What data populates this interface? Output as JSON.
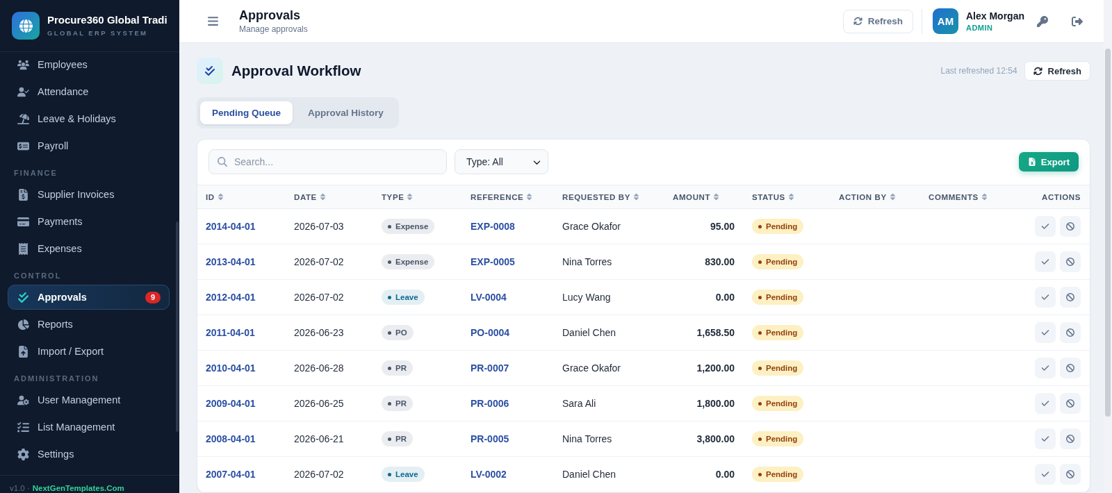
{
  "sidebar": {
    "brand": {
      "title": "Procure360 Global Tradi",
      "subtitle": "GLOBAL ERP SYSTEM"
    },
    "sections": [
      {
        "items": [
          {
            "label": "Employees",
            "selected": false
          },
          {
            "label": "Attendance",
            "selected": false
          },
          {
            "label": "Leave & Holidays",
            "selected": false
          },
          {
            "label": "Payroll",
            "selected": false
          }
        ]
      },
      {
        "label": "FINANCE",
        "items": [
          {
            "label": "Supplier Invoices",
            "selected": false
          },
          {
            "label": "Payments",
            "selected": false
          },
          {
            "label": "Expenses",
            "selected": false
          }
        ]
      },
      {
        "label": "CONTROL",
        "items": [
          {
            "label": "Approvals",
            "selected": true,
            "badge": "9"
          },
          {
            "label": "Reports",
            "selected": false
          },
          {
            "label": "Import / Export",
            "selected": false
          }
        ]
      },
      {
        "label": "ADMINISTRATION",
        "items": [
          {
            "label": "User Management",
            "selected": false
          },
          {
            "label": "List Management",
            "selected": false
          },
          {
            "label": "Settings",
            "selected": false
          }
        ]
      }
    ],
    "footer": {
      "version": "v1.0 ·",
      "link": "NextGenTemplates.Com"
    }
  },
  "topbar": {
    "title": "Approvals",
    "subtitle": "Manage approvals",
    "refresh": "Refresh",
    "user": {
      "initials": "AM",
      "name": "Alex Morgan",
      "role": "ADMIN"
    }
  },
  "page": {
    "title": "Approval Workflow",
    "last_refreshed": "Last refreshed 12:54",
    "refresh": "Refresh",
    "tabs": [
      {
        "label": "Pending Queue",
        "selected": true
      },
      {
        "label": "Approval History",
        "selected": false
      }
    ]
  },
  "table": {
    "search": {
      "placeholder": "Search..."
    },
    "type_filter": "Type: All",
    "export": "Export",
    "columns": [
      {
        "label": "ID",
        "sortable": true
      },
      {
        "label": "DATE",
        "sortable": true
      },
      {
        "label": "TYPE",
        "sortable": true
      },
      {
        "label": "REFERENCE",
        "sortable": true
      },
      {
        "label": "REQUESTED BY",
        "sortable": true
      },
      {
        "label": "AMOUNT",
        "sortable": true
      },
      {
        "label": "STATUS",
        "sortable": true
      },
      {
        "label": "ACTION BY",
        "sortable": true
      },
      {
        "label": "COMMENTS",
        "sortable": true
      },
      {
        "label": "ACTIONS",
        "sortable": false
      }
    ],
    "rows": [
      {
        "id": "2014-04-01",
        "date": "2026-07-03",
        "type": {
          "label": "Expense",
          "color": "#475569"
        },
        "reference": "EXP-0008",
        "requested_by": "Grace Okafor",
        "amount": "95.00",
        "status": "Pending"
      },
      {
        "id": "2013-04-01",
        "date": "2026-07-02",
        "type": {
          "label": "Expense",
          "color": "#475569"
        },
        "reference": "EXP-0005",
        "requested_by": "Nina Torres",
        "amount": "830.00",
        "status": "Pending"
      },
      {
        "id": "2012-04-01",
        "date": "2026-07-02",
        "type": {
          "label": "Leave",
          "color": "#0b6a93"
        },
        "reference": "LV-0004",
        "requested_by": "Lucy Wang",
        "amount": "0.00",
        "status": "Pending"
      },
      {
        "id": "2011-04-01",
        "date": "2026-06-23",
        "type": {
          "label": "PO",
          "color": "#475569"
        },
        "reference": "PO-0004",
        "requested_by": "Daniel Chen",
        "amount": "1,658.50",
        "status": "Pending"
      },
      {
        "id": "2010-04-01",
        "date": "2026-06-28",
        "type": {
          "label": "PR",
          "color": "#475569"
        },
        "reference": "PR-0007",
        "requested_by": "Grace Okafor",
        "amount": "1,200.00",
        "status": "Pending"
      },
      {
        "id": "2009-04-01",
        "date": "2026-06-25",
        "type": {
          "label": "PR",
          "color": "#475569"
        },
        "reference": "PR-0006",
        "requested_by": "Sara Ali",
        "amount": "1,800.00",
        "status": "Pending"
      },
      {
        "id": "2008-04-01",
        "date": "2026-06-21",
        "type": {
          "label": "PR",
          "color": "#475569"
        },
        "reference": "PR-0005",
        "requested_by": "Nina Torres",
        "amount": "3,800.00",
        "status": "Pending"
      },
      {
        "id": "2007-04-01",
        "date": "2026-07-02",
        "type": {
          "label": "Leave",
          "color": "#0b6a93"
        },
        "reference": "LV-0002",
        "requested_by": "Daniel Chen",
        "amount": "0.00",
        "status": "Pending"
      }
    ]
  }
}
